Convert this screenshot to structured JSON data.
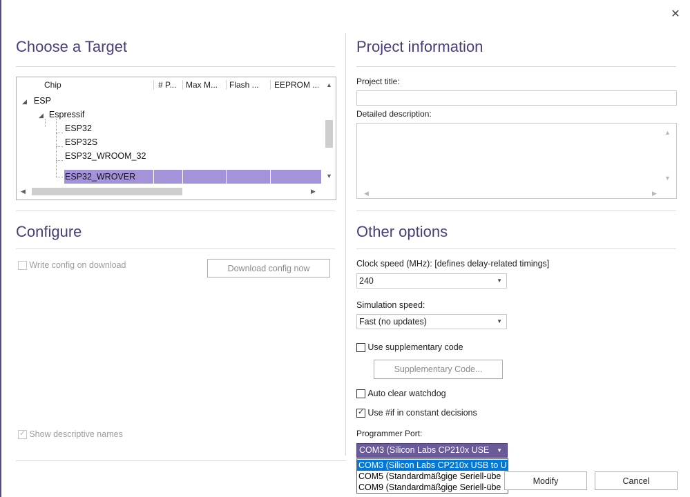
{
  "dialog": {
    "close_icon": "close-icon"
  },
  "target": {
    "title": "Choose a Target",
    "columns": [
      "Chip",
      "# P...",
      "Max M...",
      "Flash ...",
      "EEPROM ..."
    ],
    "tree": [
      {
        "label": "ESP",
        "level": 0,
        "expanded": true
      },
      {
        "label": "Espressif",
        "level": 1,
        "expanded": true
      },
      {
        "label": "ESP32",
        "level": 2
      },
      {
        "label": "ESP32S",
        "level": 2
      },
      {
        "label": "ESP32_WROOM_32",
        "level": 2
      },
      {
        "label": "ESP32_WROVER",
        "level": 2,
        "selected": true
      }
    ],
    "selection_color": "#a493d8"
  },
  "configure": {
    "title": "Configure",
    "write_config_label": "Write config on download",
    "write_config_checked": false,
    "download_button": "Download config now",
    "show_names_label": "Show descriptive names",
    "show_names_checked": true
  },
  "project": {
    "title": "Project information",
    "title_label": "Project title:",
    "title_value": "",
    "description_label": "Detailed description:",
    "description_value": ""
  },
  "options": {
    "title": "Other options",
    "clock_label": "Clock speed (MHz): [defines delay-related timings]",
    "clock_value": "240",
    "sim_label": "Simulation speed:",
    "sim_value": "Fast (no updates)",
    "supplementary_label": "Use supplementary code",
    "supplementary_checked": false,
    "supplementary_button": "Supplementary Code...",
    "watchdog_label": "Auto clear watchdog",
    "watchdog_checked": false,
    "constant_label": "Use #if in constant decisions",
    "constant_checked": true,
    "port_label": "Programmer Port:",
    "port_value": "COM3 (Silicon Labs CP210x USE",
    "port_options": [
      "COM3 (Silicon Labs CP210x USB to U",
      "COM5 (Standardmäßgige Seriell-übe",
      "COM9 (Standardmäßgige Seriell-übe"
    ]
  },
  "footer": {
    "modify": "Modify",
    "cancel": "Cancel"
  },
  "colors": {
    "accent": "#4b3d78",
    "dropdown_highlight": "#0078d7",
    "port_combo": "#6a5a98"
  }
}
